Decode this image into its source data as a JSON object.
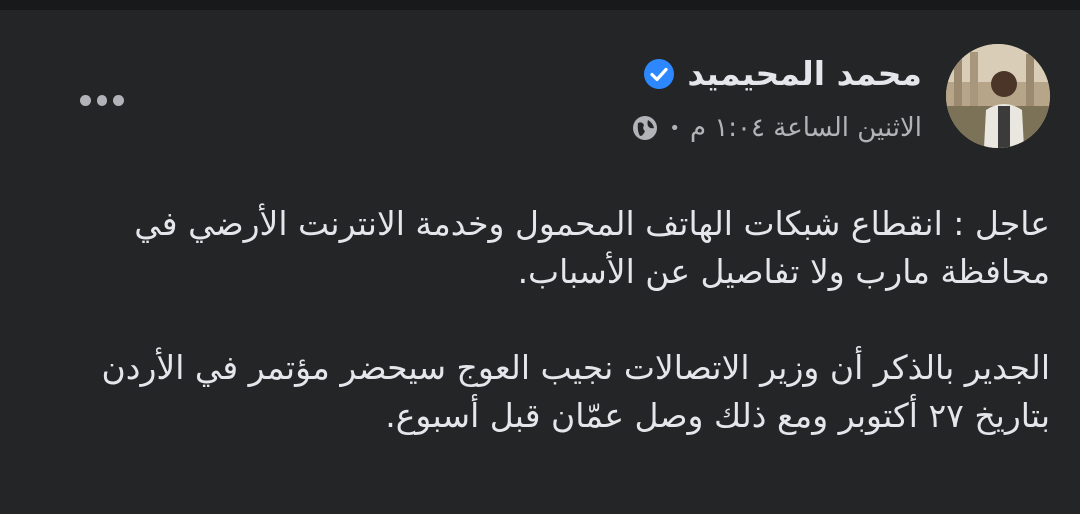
{
  "post": {
    "author_name": "محمد المحيميد",
    "verified_icon": "verified-badge-icon",
    "timestamp": "الاثنين الساعة ١:٠٤ م",
    "separator": "•",
    "audience_icon": "globe-icon",
    "more_icon": "more-options-icon",
    "paragraphs": [
      "عاجل : انقطاع شبكات الهاتف المحمول وخدمة الانترنت الأرضي في محافظة مارب ولا تفاصيل عن الأسباب.",
      "الجدير بالذكر أن وزير الاتصالات نجيب العوج سيحضر مؤتمر في الأردن بتاريخ ٢٧ أكتوبر ومع ذلك وصل عمّان قبل أسبوع."
    ]
  },
  "colors": {
    "background": "#242526",
    "text_primary": "#e4e6eb",
    "text_secondary": "#b0b3b8",
    "verified_blue": "#2d88ff"
  }
}
